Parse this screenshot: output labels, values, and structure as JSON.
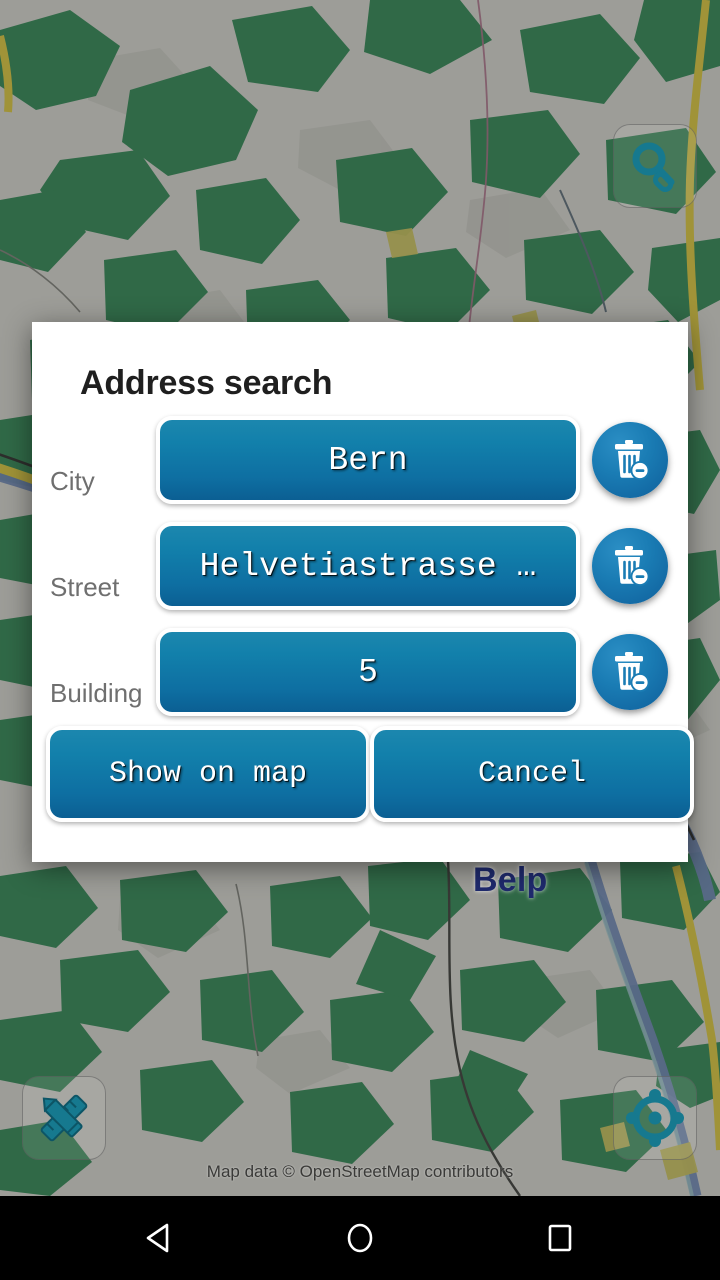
{
  "app": {
    "kind": "offline-map-navigation-app",
    "platform": "android"
  },
  "map": {
    "labels": [
      {
        "name": "Belp",
        "text": "Belp",
        "color": "#1f2a6e"
      }
    ],
    "attribution": "Map data © OpenStreetMap contributors",
    "colors": {
      "land": "#e4e2de",
      "forest": "#3f9463",
      "water": "#7b93c4",
      "road_primary": "#e8d44d",
      "road_minor": "#ffffff",
      "railway": "#3a3a3a",
      "boundary": "#c07a9a"
    },
    "buttons": [
      {
        "name": "search-button",
        "icon": "search-icon",
        "position": "top-right",
        "tint": "#16798f"
      },
      {
        "name": "measure-button",
        "icon": "ruler-pencil-icon",
        "position": "bottom-left",
        "tint": "#16798f"
      },
      {
        "name": "locate-button",
        "icon": "crosshair-location-icon",
        "position": "bottom-right",
        "tint": "#16798f"
      }
    ]
  },
  "dialog": {
    "title": "Address search",
    "accent_top": "#1c87ae",
    "accent_bottom": "#0b5f93",
    "fields": [
      {
        "key": "city",
        "label": "City",
        "value": "Bern",
        "clear_icon": "trash-minus-icon",
        "clear_label": "Clear city"
      },
      {
        "key": "street",
        "label": "Street",
        "value": "Helvetiastrasse …",
        "clear_icon": "trash-minus-icon",
        "clear_label": "Clear street"
      },
      {
        "key": "building",
        "label": "Building",
        "value": "5",
        "clear_icon": "trash-minus-icon",
        "clear_label": "Clear building"
      }
    ],
    "actions": {
      "primary": "Show on map",
      "secondary": "Cancel"
    }
  },
  "navbar": {
    "back": "back-triangle-icon",
    "home": "home-circle-icon",
    "recents": "recents-square-icon"
  }
}
